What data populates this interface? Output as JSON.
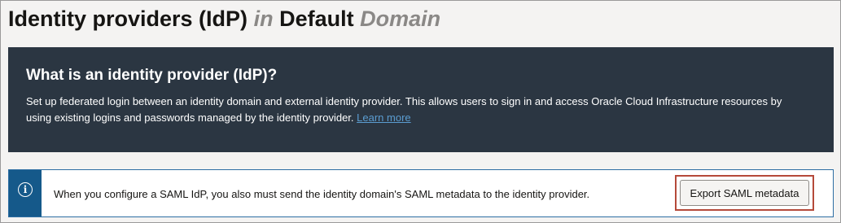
{
  "header": {
    "title_main": "Identity providers (IdP)",
    "title_in": "in",
    "title_domain_name": "Default",
    "title_domain_word": "Domain"
  },
  "info_banner": {
    "title": "What is an identity provider (IdP)?",
    "description": "Set up federated login between an identity domain and external identity provider. This allows users to sign in and access Oracle Cloud Infrastructure resources by using existing logins and passwords managed by the identity provider.",
    "link_label": "Learn more"
  },
  "notice": {
    "icon": "info-icon",
    "text": "When you configure a SAML IdP, you also must send the identity domain's SAML metadata to the identity provider.",
    "button_label": "Export SAML metadata"
  },
  "colors": {
    "banner_bg": "#2b3642",
    "notice_stripe": "#15598a",
    "highlight_border": "#b54a3a",
    "link": "#5b9dd1"
  }
}
